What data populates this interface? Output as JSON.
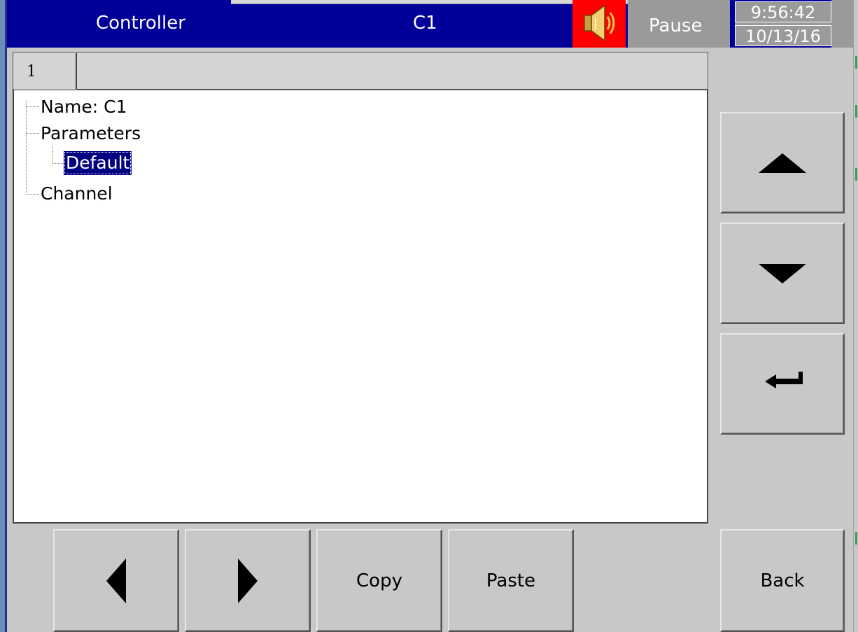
{
  "header": {
    "title": "Controller",
    "item": "C1",
    "pause_label": "Pause",
    "time": "9:56:42",
    "date": "10/13/16",
    "speaker_icon": "speaker-icon",
    "colors": {
      "bar": "#000099",
      "speaker_bg": "#ff0000",
      "status_bg": "#9a9a9a"
    }
  },
  "tabs": [
    {
      "label": "1"
    }
  ],
  "tree": {
    "nodes": [
      {
        "label": "Name: C1",
        "level": 0
      },
      {
        "label": "Parameters",
        "level": 0
      },
      {
        "label": "Default",
        "level": 1,
        "selected": true
      },
      {
        "label": "Channel",
        "level": 0
      }
    ]
  },
  "side_buttons": {
    "up_icon": "triangle-up-icon",
    "down_icon": "triangle-down-icon",
    "enter_icon": "enter-arrow-icon"
  },
  "bottom_buttons": {
    "left_icon": "triangle-left-icon",
    "right_icon": "triangle-right-icon",
    "copy_label": "Copy",
    "paste_label": "Paste",
    "back_label": "Back"
  }
}
